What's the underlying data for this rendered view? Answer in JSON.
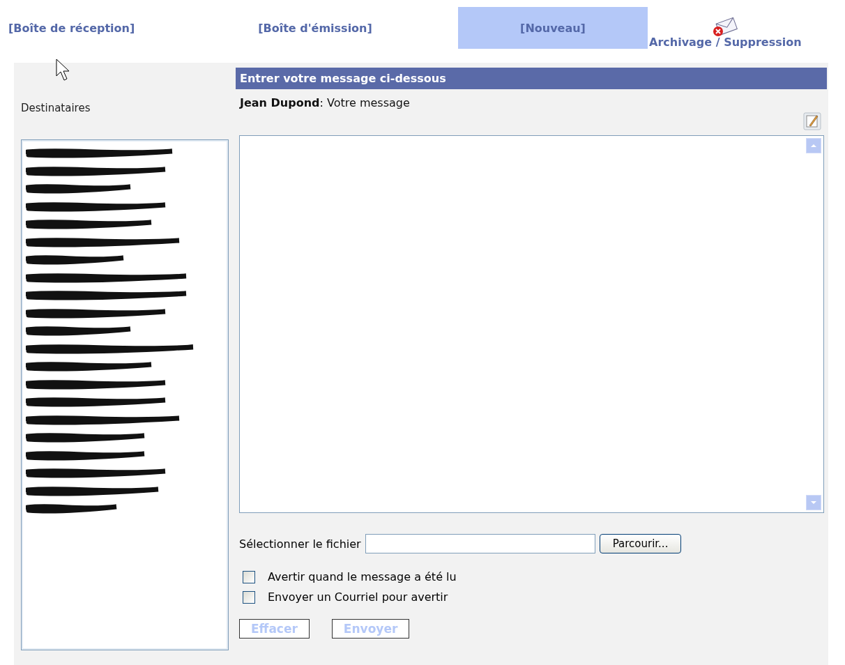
{
  "nav": [
    {
      "label": "[Boîte de réception]",
      "selected": false
    },
    {
      "label": "[Boîte d'émission]",
      "selected": false
    },
    {
      "label": "[Nouveau]",
      "selected": true
    }
  ],
  "archive_link": {
    "label": "Archivage / Suppression"
  },
  "recipients": {
    "label": "Destinataires",
    "items": [
      {
        "kind": "redacted"
      },
      {
        "kind": "redacted"
      },
      {
        "kind": "redacted"
      },
      {
        "kind": "redacted"
      },
      {
        "kind": "redacted"
      },
      {
        "kind": "redacted"
      },
      {
        "kind": "redacted"
      },
      {
        "kind": "redacted"
      },
      {
        "kind": "redacted"
      },
      {
        "kind": "redacted"
      },
      {
        "kind": "redacted"
      },
      {
        "kind": "redacted"
      },
      {
        "kind": "redacted"
      },
      {
        "kind": "redacted"
      },
      {
        "kind": "redacted"
      },
      {
        "kind": "redacted"
      },
      {
        "kind": "redacted"
      },
      {
        "kind": "redacted"
      },
      {
        "kind": "redacted"
      },
      {
        "kind": "redacted"
      },
      {
        "kind": "redacted"
      }
    ]
  },
  "compose": {
    "header": "Entrer votre message ci-dessous",
    "sender": "Jean Dupond",
    "prompt": ": Votre message"
  },
  "file": {
    "label": "Sélectionner le fichier",
    "button": "Parcourir..."
  },
  "options": [
    {
      "label": "Avertir quand le message a été lu",
      "checked": false
    },
    {
      "label": "Envoyer un Courriel pour avertir",
      "checked": false
    }
  ],
  "buttons": [
    "Effacer",
    "Envoyer"
  ]
}
